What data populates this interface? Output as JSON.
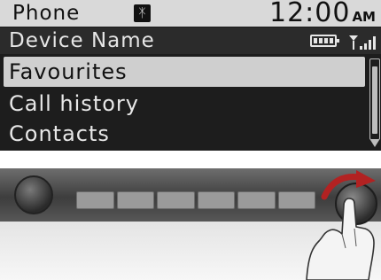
{
  "display": {
    "title": "Phone",
    "bluetooth_icon": "bluetooth-icon",
    "clock": {
      "time": "12:00",
      "ampm": "AM"
    },
    "device_name": "Device Name",
    "battery_icon": "battery-icon",
    "signal_icon": "signal-strength-icon",
    "menu": [
      {
        "label": "Favourites",
        "selected": true
      },
      {
        "label": "Call history",
        "selected": false
      },
      {
        "label": "Contacts",
        "selected": false
      }
    ],
    "colors": {
      "background": "#1d1d1d",
      "title_bar": "#d9d9d9",
      "selection": "#cfcfcf",
      "accent_arrow": "#b22222"
    }
  },
  "illustration": {
    "rotate_arrow_icon": "rotate-clockwise-arrow-icon",
    "hand_icon": "hand-pointer-icon"
  }
}
